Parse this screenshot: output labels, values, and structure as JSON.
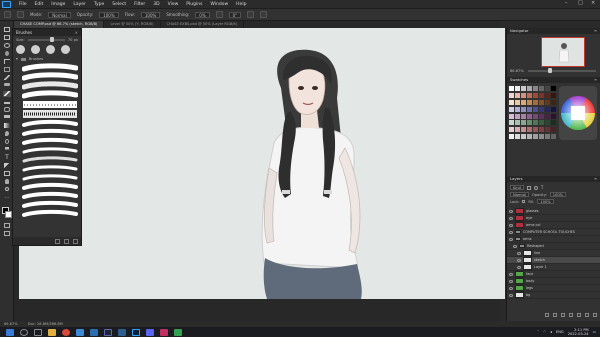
{
  "menubar": {
    "items": [
      "File",
      "Edit",
      "Image",
      "Layer",
      "Type",
      "Select",
      "Filter",
      "3D",
      "View",
      "Plugins",
      "Window",
      "Help"
    ]
  },
  "options": {
    "mode_label": "Mode:",
    "mode_value": "Normal",
    "opacity_label": "Opacity:",
    "opacity_value": "100%",
    "flow_label": "Flow:",
    "flow_value": "100%",
    "smoothing_label": "Smoothing:",
    "smoothing_value": "0%",
    "angle_value": "0°"
  },
  "tabs": [
    {
      "label": "CHASE COMP.psd @ 66.7% (sketch, RGB/8)"
    },
    {
      "label": "Level @ 50% (Y, RGB/8)"
    },
    {
      "label": "CHASE EXBS.psd @ 50% (Layer RGB/8)"
    }
  ],
  "brush_panel": {
    "title": "Brushes",
    "size_label": "Size:",
    "size_value": "70 px",
    "folder_label": "Brushes"
  },
  "right": {
    "navigator_title": "Navigator",
    "zoom_value": "66.67%",
    "swatches_title": "Swatches",
    "layers_title": "Layers",
    "kind_label": "Kind",
    "blend_value": "Normal",
    "opacity_label": "Opacity:",
    "opacity_value": "100%",
    "lock_label": "Lock:",
    "fill_label": "Fill:",
    "fill_value": "100%"
  },
  "layers": [
    {
      "name": "glasses",
      "thumb": "red"
    },
    {
      "name": "eye",
      "thumb": "red"
    },
    {
      "name": "arms col",
      "thumb": "red"
    },
    {
      "name": "COMPUTER SCHOOL TOUCHES",
      "thumb": "folder"
    },
    {
      "name": "arms",
      "thumb": "folder"
    },
    {
      "name": "Reshaped",
      "thumb": "folder"
    },
    {
      "name": "line",
      "thumb": "white"
    },
    {
      "name": "sketch",
      "thumb": "white"
    },
    {
      "name": "Layer 1",
      "thumb": "white"
    },
    {
      "name": "face",
      "thumb": "green"
    },
    {
      "name": "body",
      "thumb": "green"
    },
    {
      "name": "legs",
      "thumb": "green"
    },
    {
      "name": "bg",
      "thumb": "white"
    }
  ],
  "status": {
    "zoom": "66.67%",
    "doc": "Doc: 28.8M/366.8M"
  },
  "taskbar": {
    "time": "2:11 PM",
    "date": "2022-03-24",
    "lang": "ENG"
  }
}
